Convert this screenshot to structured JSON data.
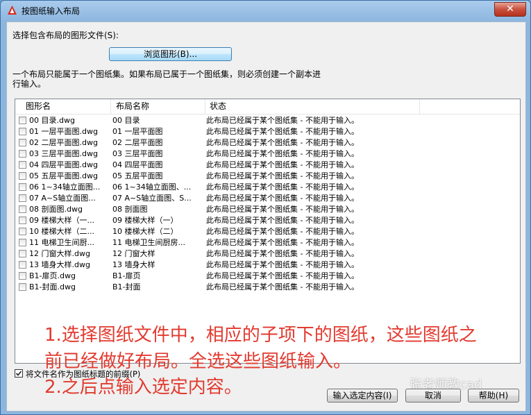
{
  "window": {
    "title": "按图纸输入布局",
    "close_label": "✕"
  },
  "prompt": "选择包含布局的图形文件(S):",
  "browse_label": "浏览图形(B)...",
  "info_line1": "一个布局只能属于一个图纸集。如果布局已属于一个图纸集，则必须创建一个副本进",
  "info_line2": "行输入。",
  "columns": [
    "图形名",
    "布局名称",
    "状态"
  ],
  "rows": [
    [
      "00 目录.dwg",
      "00 目录",
      "此布局已经属于某个图纸集 - 不能用于输入。"
    ],
    [
      "01 一层平面图.dwg",
      "01 一层平面图",
      "此布局已经属于某个图纸集 - 不能用于输入。"
    ],
    [
      "02 二层平面图.dwg",
      "02 二层平面图",
      "此布局已经属于某个图纸集 - 不能用于输入。"
    ],
    [
      "03 三层平面图.dwg",
      "03 三层平面图",
      "此布局已经属于某个图纸集 - 不能用于输入。"
    ],
    [
      "04 四层平面图.dwg",
      "04 四层平面图",
      "此布局已经属于某个图纸集 - 不能用于输入。"
    ],
    [
      "05 五层平面图.dwg",
      "05 五层平面图",
      "此布局已经属于某个图纸集 - 不能用于输入。"
    ],
    [
      "06 1~34轴立面图...",
      "06 1~34轴立面图、...",
      "此布局已经属于某个图纸集 - 不能用于输入。"
    ],
    [
      "07 A~S轴立面图...",
      "07 A~S轴立面图、S...",
      "此布局已经属于某个图纸集 - 不能用于输入。"
    ],
    [
      "08 剖面图.dwg",
      "08 剖面图",
      "此布局已经属于某个图纸集 - 不能用于输入。"
    ],
    [
      "09 楼梯大样（一...",
      "09 楼梯大样（一）",
      "此布局已经属于某个图纸集 - 不能用于输入。"
    ],
    [
      "10 楼梯大样（二...",
      "10 楼梯大样（二）",
      "此布局已经属于某个图纸集 - 不能用于输入。"
    ],
    [
      "11 电梯卫生间厨...",
      "11 电梯卫生间厨房...",
      "此布局已经属于某个图纸集 - 不能用于输入。"
    ],
    [
      "12 门窗大样.dwg",
      "12 门窗大样",
      "此布局已经属于某个图纸集 - 不能用于输入。"
    ],
    [
      "13 墙身大样.dwg",
      "13 墙身大样",
      "此布局已经属于某个图纸集 - 不能用于输入。"
    ],
    [
      "B1-扉页.dwg",
      "B1-扉页",
      "此布局已经属于某个图纸集 - 不能用于输入。"
    ],
    [
      "B1-封面.dwg",
      "B1-封面",
      "此布局已经属于某个图纸集 - 不能用于输入。"
    ]
  ],
  "annotation_line1": "1.选择图纸文件中，相应的子项下的图纸，这些图纸之",
  "annotation_line2": "前已经做好布局。全选这些图纸输入。",
  "annotation_line3": "2.之后点输入选定内容。",
  "prefix_checkbox_label": "将文件名作为图纸标题的前缀(P)",
  "prefix_checked": true,
  "watermark": "张老师教cad",
  "buttons": {
    "import": "输入选定内容(I)",
    "cancel": "取消",
    "help": "帮助(H)"
  },
  "colors": {
    "annotation": "#e23a2f",
    "titlebar": "#8db6df"
  }
}
